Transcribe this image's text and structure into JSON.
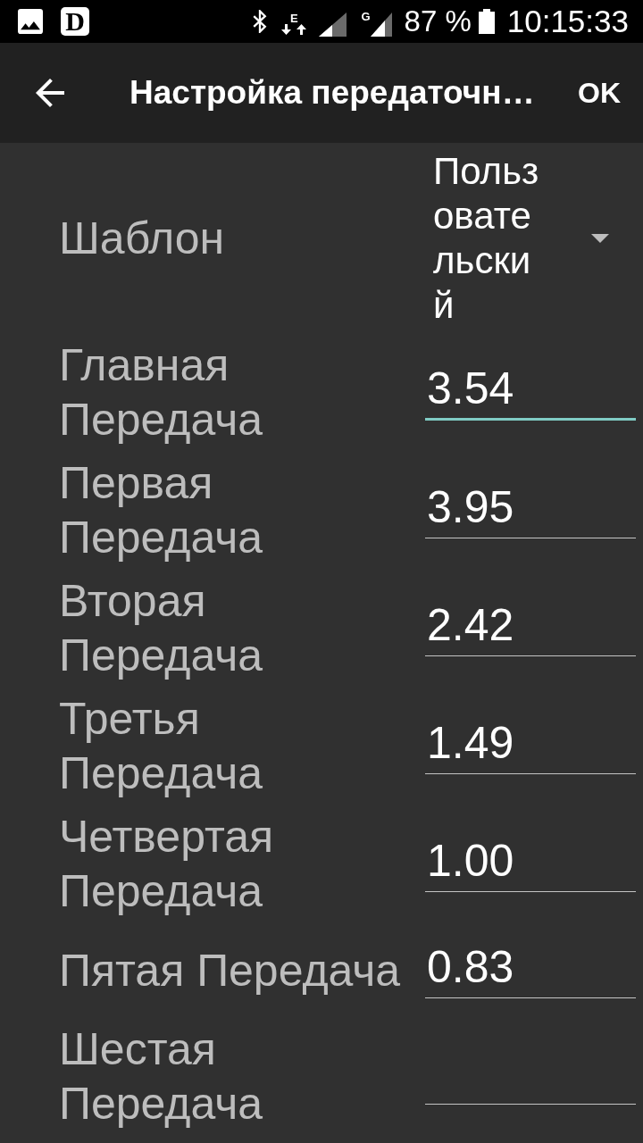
{
  "status_bar": {
    "app_letter": "D",
    "data_type": "E",
    "signal_type": "G",
    "battery": "87 %",
    "time": "10:15:33"
  },
  "app_bar": {
    "title": "Настройка передаточн…",
    "action": "OK"
  },
  "template": {
    "label": "Шаблон",
    "value": "Пользовательский"
  },
  "gears": [
    {
      "label": "Главная Передача",
      "value": "3.54",
      "focused": true
    },
    {
      "label": "Первая Передача",
      "value": "3.95",
      "focused": false
    },
    {
      "label": "Вторая Передача",
      "value": "2.42",
      "focused": false
    },
    {
      "label": "Третья Передача",
      "value": "1.49",
      "focused": false
    },
    {
      "label": "Четвертая Передача",
      "value": "1.00",
      "focused": false
    },
    {
      "label": "Пятая Передача",
      "value": "0.83",
      "focused": false
    },
    {
      "label": "Шестая Передача",
      "focused": false
    }
  ]
}
